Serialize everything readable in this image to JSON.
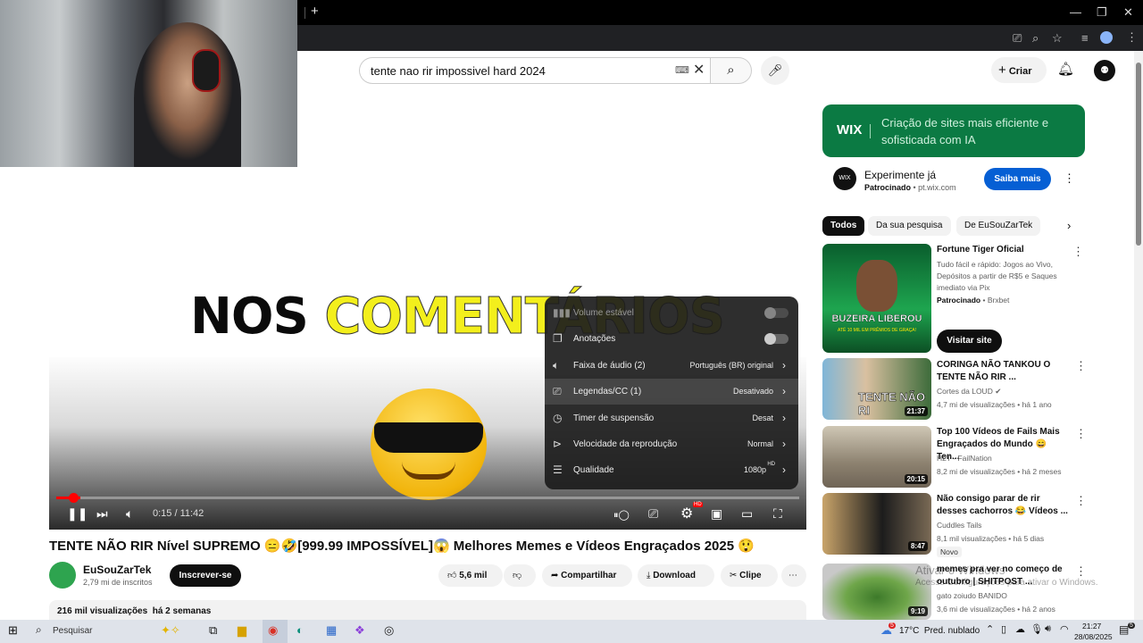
{
  "browser": {
    "new_tab": "+",
    "window_controls": [
      "—",
      "❐",
      "✕"
    ]
  },
  "youtube_header": {
    "search_value": "tente nao rir impossivel hard 2024",
    "create_label": "Criar"
  },
  "player": {
    "overlay_text_dark": "NOS",
    "overlay_text_yellow": "COMENTÁRIOS",
    "time": "0:15 / 11:42",
    "progress": 0.021,
    "settings_menu": [
      {
        "label": "Volume estável",
        "value": "",
        "type": "toggle",
        "dim": true
      },
      {
        "label": "Anotações",
        "value": "",
        "type": "toggle"
      },
      {
        "label": "Faixa de áudio (2)",
        "value": "Português (BR) original",
        "type": "submenu"
      },
      {
        "label": "Legendas/CC (1)",
        "value": "Desativado",
        "type": "submenu"
      },
      {
        "label": "Timer de suspensão",
        "value": "Desat",
        "type": "submenu"
      },
      {
        "label": "Velocidade da reprodução",
        "value": "Normal",
        "type": "submenu"
      },
      {
        "label": "Qualidade",
        "value": "1080p",
        "type": "submenu",
        "badge": "HD"
      }
    ]
  },
  "video": {
    "title": "TENTE NÃO RIR Nível SUPREMO 😑🤣[999.99 IMPOSSÍVEL]😱 Melhores Memes e Vídeos Engraçados 2025 😲",
    "channel": "EuSouZarTek",
    "subscribers": "2,79 mi de inscritos",
    "subscribe_label": "Inscrever-se",
    "likes": "5,6 mil",
    "share_label": "Compartilhar",
    "download_label": "Download",
    "clip_label": "Clipe",
    "views": "216 mil visualizações",
    "age": "há 2 semanas"
  },
  "ad": {
    "banner_brand": "WIX",
    "banner_text": "Criação de sites mais eficiente e sofisticada com IA",
    "logo_text": "WIX",
    "title": "Experimente já",
    "sponsored": "Patrocinado",
    "domain": "pt.wix.com",
    "cta": "Saiba mais"
  },
  "chips": [
    "Todos",
    "Da sua pesquisa",
    "De EuSouZarTek"
  ],
  "recommendations": [
    {
      "title": "Fortune Tiger Oficial",
      "desc": "Tudo fácil e rápido: Jogos ao Vivo, Depósitos a partir de R$5 e Saques imediato via Pix",
      "sponsored": "Patrocinado",
      "advertiser": "Brxbet",
      "cta": "Visitar site",
      "thumb_text": "BUZEIRA LIBEROU",
      "thumb_sub": "ATÉ 10 MIL EM PRÊMIOS DE GRAÇA!"
    },
    {
      "title": "CORINGA NÃO TANKOU O TENTE NÃO RIR ...",
      "channel": "Cortes da LOUD",
      "meta": "4,7 mi de visualizações • há 1 ano",
      "duration": "21:37",
      "thumb_text": "TENTE NÃO RI"
    },
    {
      "title": "Top 100 Vídeos de Fails Mais Engraçados do Mundo 😄 Ten...",
      "channel": "H2T - FailNation",
      "meta": "8,2 mi de visualizações • há 2 meses",
      "duration": "20:15"
    },
    {
      "title": "Não consigo parar de rir desses cachorros 😂 Vídeos ...",
      "channel": "Cuddles Tails",
      "meta": "8,1 mil visualizações • há 5 dias",
      "badge": "Novo",
      "duration": "8:47"
    },
    {
      "title": "memes pra ver no começo de outubro | SHITPOST ...",
      "channel": "gato zoiudo BANIDO",
      "meta": "3,6 mi de visualizações • há 2 anos",
      "duration": "9:19"
    }
  ],
  "watermark": {
    "line1": "Ativar o Windows",
    "line2": "Acesse Configurações para ativar o Windows."
  },
  "taskbar": {
    "search_placeholder": "Pesquisar",
    "weather": "17°C  Pred. nublado",
    "time": "21:27",
    "date": "28/08/2025",
    "notif_count": "5"
  }
}
